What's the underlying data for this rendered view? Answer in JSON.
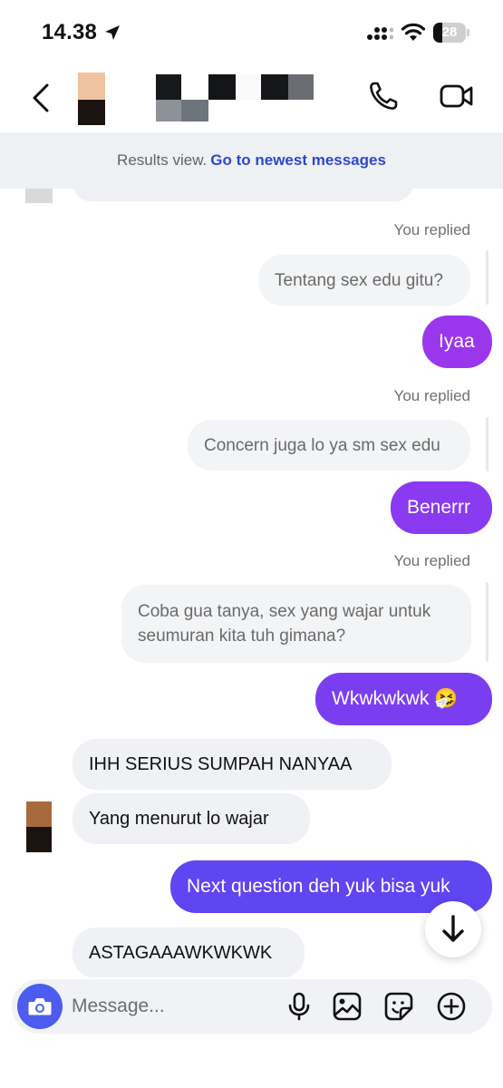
{
  "status": {
    "time": "14.38",
    "battery": 28
  },
  "header": {
    "back_icon": "chevron-left-icon",
    "call_icon": "phone-icon",
    "video_icon": "video-camera-icon"
  },
  "banner": {
    "text": "Results view.",
    "link": "Go to newest messages"
  },
  "messages": {
    "r1_label": "You replied",
    "r1_quote": "Tentang sex edu gitu?",
    "r1_reply": "Iyaa",
    "r2_label": "You replied",
    "r2_quote": "Concern juga lo ya sm sex edu",
    "r2_reply": "Benerrr",
    "r3_label": "You replied",
    "r3_quote": "Coba gua tanya, sex yang wajar untuk seumuran kita tuh gimana?",
    "r3_reply": "Wkwkwkwk 🤧",
    "in1": "IHH SERIUS SUMPAH NANYAA",
    "in2": "Yang menurut lo wajar",
    "out4": "Next question deh yuk bisa yuk",
    "in3": "ASTAGAAAWKWKWK"
  },
  "composer": {
    "placeholder": "Message..."
  },
  "colors": {
    "accent_purple_1": "#9a37ed",
    "accent_purple_2": "#7a3ef0",
    "accent_blue": "#6045f2",
    "link": "#2e48c8",
    "camera": "#4d5cf0"
  }
}
